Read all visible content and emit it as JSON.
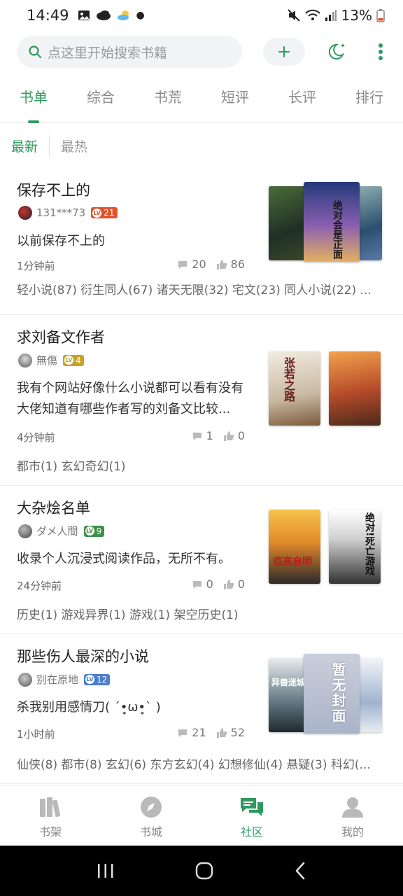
{
  "status": {
    "time": "14:49",
    "battery": "13%"
  },
  "search": {
    "placeholder": "点这里开始搜索书籍"
  },
  "tabs": [
    "书单",
    "综合",
    "书荒",
    "短评",
    "长评",
    "排行"
  ],
  "sort": {
    "newest": "最新",
    "hottest": "最热"
  },
  "items": [
    {
      "title": "保存不上的",
      "user": "131***73",
      "level": "21",
      "desc": "以前保存不上的",
      "time": "1分钟前",
      "comments": "20",
      "likes": "86",
      "tags": "轻小说(87) 衍生同人(67) 诸天无限(32) 宅文(23) 同人小说(22) ..."
    },
    {
      "title": "求刘备文作者",
      "user": "無傷",
      "level": "4",
      "desc": "我有个网站好像什么小说都可以看有没有大佬知道有哪些作者写的刘备文比较...",
      "time": "4分钟前",
      "comments": "1",
      "likes": "0",
      "tags": "都市(1) 玄幻奇幻(1)"
    },
    {
      "title": "大杂烩名单",
      "user": "ダメ人間",
      "level": "9",
      "desc": "收录个人沉浸式阅读作品，无所不有。",
      "time": "24分钟前",
      "comments": "0",
      "likes": "0",
      "tags": "历史(1) 游戏异界(1) 游戏(1) 架空历史(1)"
    },
    {
      "title": "那些伤人最深的小说",
      "user": "别在原地",
      "level": "12",
      "desc": "杀我别用感情刀( ´•̥ω•̥` )",
      "time": "1小时前",
      "comments": "21",
      "likes": "52",
      "tags": "仙侠(8) 都市(8) 玄幻(6) 东方玄幻(4) 幻想修仙(4) 悬疑(3) 科幻(..."
    }
  ],
  "cover_text": {
    "c1_center": "绝对会是正面",
    "c2_left": "张若之路",
    "c3_left": "临高启明",
    "c3_right": "绝对!死亡游戏",
    "c4_left": "异兽迷城",
    "c4_center": "暂无封面"
  },
  "nav": [
    "书架",
    "书城",
    "社区",
    "我的"
  ],
  "colors": {
    "accent": "#2e9a60"
  }
}
